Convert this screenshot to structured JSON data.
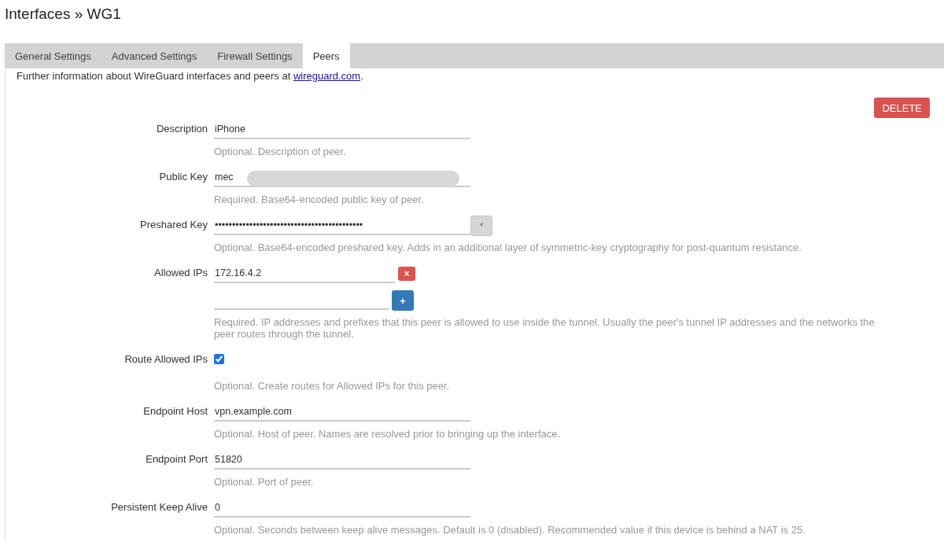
{
  "page": {
    "title": "Interfaces » WG1"
  },
  "tabs": [
    {
      "label": "General Settings",
      "selected": false
    },
    {
      "label": "Advanced Settings",
      "selected": false
    },
    {
      "label": "Firewall Settings",
      "selected": false
    },
    {
      "label": "Peers",
      "selected": true
    }
  ],
  "info": {
    "text": "Further information about WireGuard interfaces and peers at ",
    "link": "wireguard.com",
    "after": "."
  },
  "delete_button": "DELETE",
  "fields": [
    {
      "kind": "text",
      "label": "Description",
      "value": "iPhone",
      "hint": "Optional. Description of peer."
    },
    {
      "kind": "text",
      "label": "Public Key",
      "value": "mec",
      "redacted": true,
      "hint": "Required. Base64-encoded public key of peer."
    },
    {
      "kind": "password",
      "label": "Preshared Key",
      "value": "•••••••••••••••••••••••••••••••••••••••••••",
      "button": "*",
      "hint": "Optional. Base64-encoded preshared key. Adds in an additional layer of symmetric-key cryptography for post-quantum resistance."
    },
    {
      "kind": "list",
      "label": "Allowed IPs",
      "items": [
        {
          "value": "172.16.4.2",
          "kind": "remove",
          "button": "×"
        },
        {
          "kind": "add",
          "button": "+"
        }
      ],
      "hint": "Required. IP addresses and prefixes that this peer is allowed to use inside the tunnel. Usually the peer's tunnel IP addresses and the networks the peer routes through the tunnel."
    },
    {
      "kind": "checkbox",
      "label": "Route Allowed IPs",
      "checked": true,
      "hint": "Optional. Create routes for Allowed IPs for this peer."
    },
    {
      "kind": "text",
      "label": "Endpoint Host",
      "value": "vpn.example.com",
      "hint": "Optional. Host of peer. Names are resolved prior to bringing up the interface."
    },
    {
      "kind": "text",
      "label": "Endpoint Port",
      "value": "51820",
      "hint": "Optional. Port of peer."
    },
    {
      "kind": "text",
      "label": "Persistent Keep Alive",
      "value": "0",
      "hint": "Optional. Seconds between keep alive messages. Default is 0 (disabled). Recommended value if this device is behind a NAT is 25."
    }
  ]
}
